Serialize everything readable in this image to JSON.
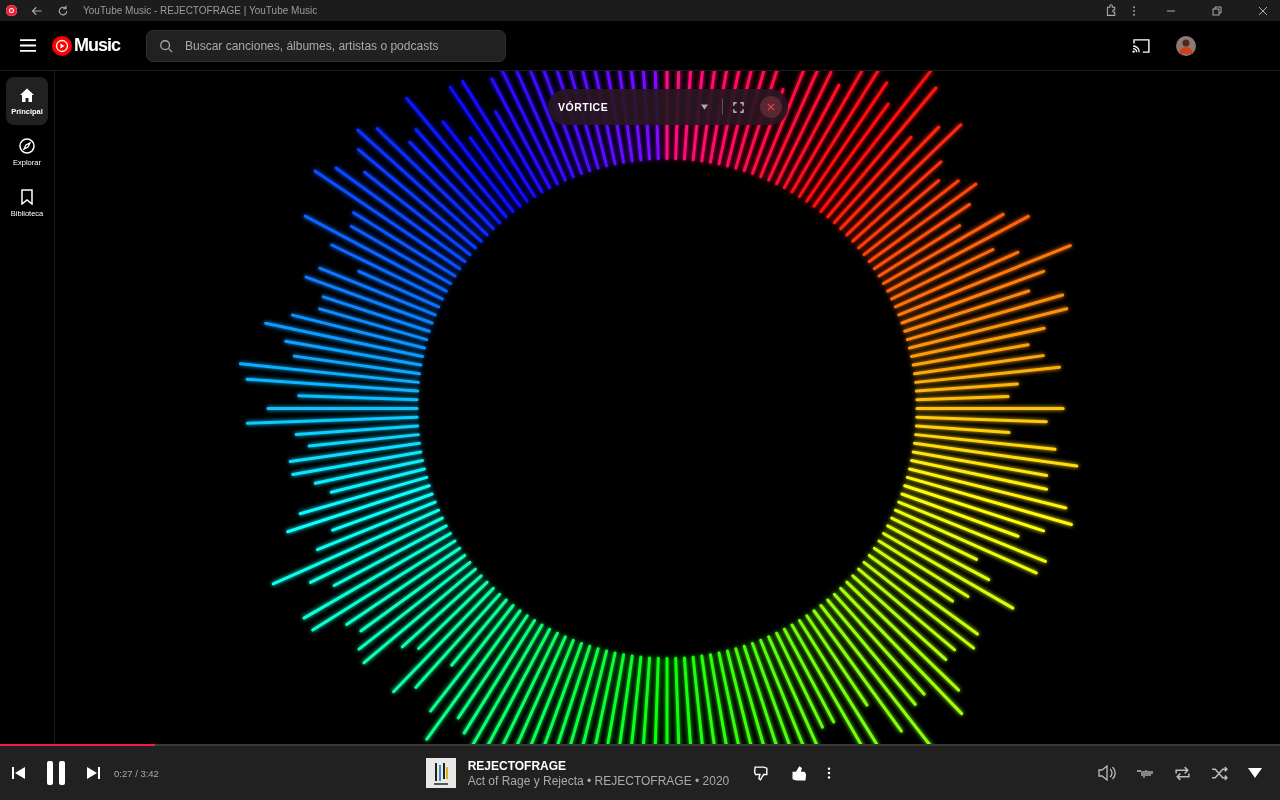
{
  "window": {
    "title": "YouTube Music - REJECTOFRAGE | YouTube Music"
  },
  "header": {
    "logo": "Music",
    "search": {
      "placeholder": "Buscar canciones, álbumes, artistas o podcasts"
    }
  },
  "sidebar": {
    "items": [
      {
        "label": "Principal",
        "selected": true
      },
      {
        "label": "Explorar",
        "selected": false
      },
      {
        "label": "Biblioteca",
        "selected": false
      }
    ]
  },
  "visualizer": {
    "preset": "VÓRTICE"
  },
  "player": {
    "level": 0.121,
    "time": "0:27 / 3:42",
    "title": "REJECTOFRAGE",
    "subtitle": "Act of Rage y Rejecta • REJECTOFRAGE • 2020",
    "liked": true,
    "disliked": false
  }
}
